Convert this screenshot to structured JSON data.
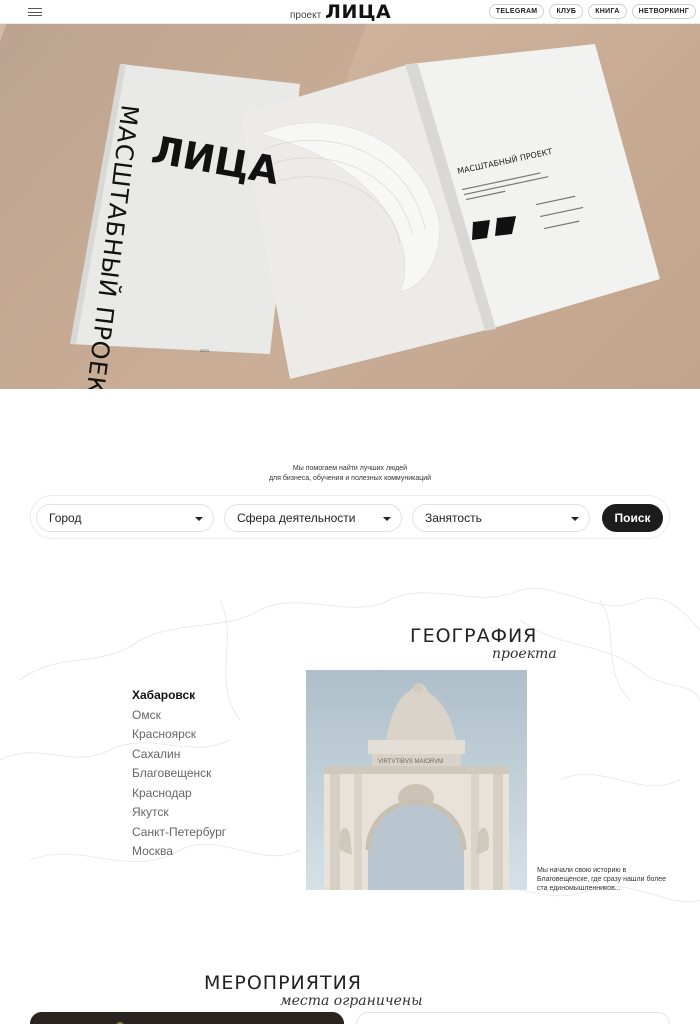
{
  "header": {
    "logo_small": "проект",
    "logo_big": "ЛИЦА",
    "nav": [
      "TELEGRAM",
      "КЛУБ",
      "КНИГА",
      "НЕТВОРКИНГ"
    ]
  },
  "hero": {
    "cover_brand": "ЛИЦА",
    "cover_vertical": "МАСШТАБНЫЙ ПРОЕКТ",
    "page_heading": "МАСШТАБНЫЙ ПРОЕКТ",
    "page_text": "созданный для эффективного взаимодействия и сотрудничества целеустремлённых, активных жителей региона",
    "bullets": [
      "об активных людях;",
      "уникальных местах;",
      "ярких событиях."
    ]
  },
  "tagline": {
    "line1": "Мы помогаем найти лучших людей",
    "line2": "для бизнеса, обучения и полезных коммуникаций"
  },
  "search": {
    "city": "Город",
    "sphere": "Сфера деятельности",
    "employment": "Занятость",
    "button": "Поиск"
  },
  "geography": {
    "title": "ГЕОГРАФИЯ",
    "subtitle": "проекта",
    "cities": [
      "Хабаровск",
      "Омск",
      "Красноярск",
      "Сахалин",
      "Благовещенск",
      "Краснодар",
      "Якутск",
      "Санкт-Петербург",
      "Москва"
    ],
    "active_city": "Хабаровск",
    "caption": "Мы начали свою историю в Благовещенске, где сразу нашли более ста единомышленников..."
  },
  "events": {
    "title": "МЕРОПРИЯТИЯ",
    "subtitle": "места ограничены"
  }
}
